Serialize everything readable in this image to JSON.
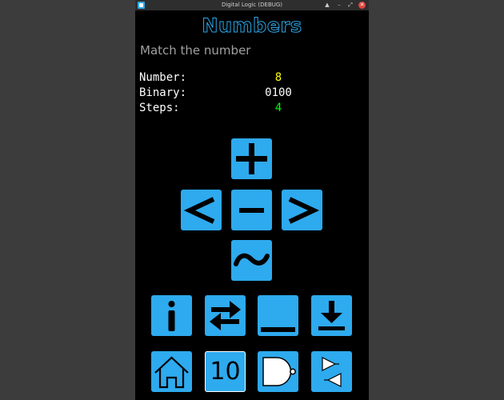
{
  "window": {
    "title": "Digital Logic (DEBUG)",
    "controls": {
      "up": "▲",
      "minimize": "–",
      "restore": "⤢",
      "close": "✕"
    }
  },
  "page": {
    "heading": "Numbers",
    "subtitle": "Match the number"
  },
  "info": {
    "number_label": "Number:",
    "number_value": "8",
    "binary_label": "Binary:",
    "binary_value": "0100",
    "steps_label": "Steps:",
    "steps_value": "4"
  },
  "colors": {
    "accent": "#2eaaee",
    "number": "#ffff00",
    "binary": "#ffffff",
    "steps": "#00ff00"
  },
  "controls": {
    "plus": "plus-icon",
    "left": "less-than-icon",
    "minus": "minus-icon",
    "right": "greater-than-icon",
    "tilde": "tilde-icon"
  },
  "toolbar": {
    "info": "info-icon",
    "swap": "swap-arrows-icon",
    "underscore": "underscore-icon",
    "download": "download-icon",
    "home": "home-icon",
    "base_label": "10",
    "gate": "nand-gate-icon",
    "buffers": "buffer-pair-icon"
  }
}
